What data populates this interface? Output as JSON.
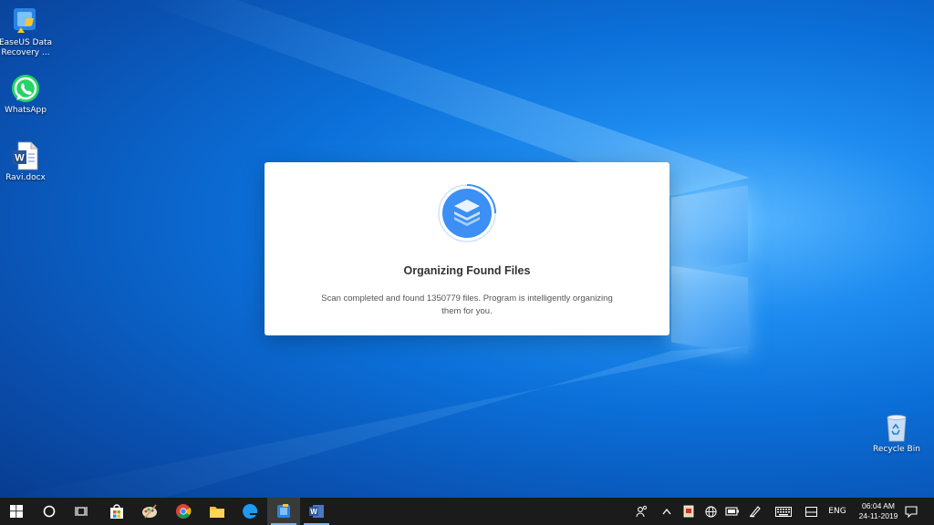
{
  "desktop": {
    "icons": [
      {
        "label": "EaseUS Data Recovery ..."
      },
      {
        "label": "WhatsApp"
      },
      {
        "label": "Ravi.docx"
      },
      {
        "label": "Recycle Bin"
      }
    ]
  },
  "dialog": {
    "title": "Organizing Found Files",
    "message": "Scan completed and found 1350779 files. Program is intelligently organizing them for you."
  },
  "taskbar": {
    "lang": "ENG",
    "time": "06:04 AM",
    "date": "24-11-2019",
    "apps": [
      "start",
      "cortana",
      "task-view",
      "store",
      "paint",
      "chrome",
      "file-explorer",
      "edge",
      "easeus",
      "word"
    ]
  },
  "colors": {
    "accent": "#3b8ff5",
    "taskbar": "#1b1b1b",
    "dialog_title": "#333333"
  }
}
